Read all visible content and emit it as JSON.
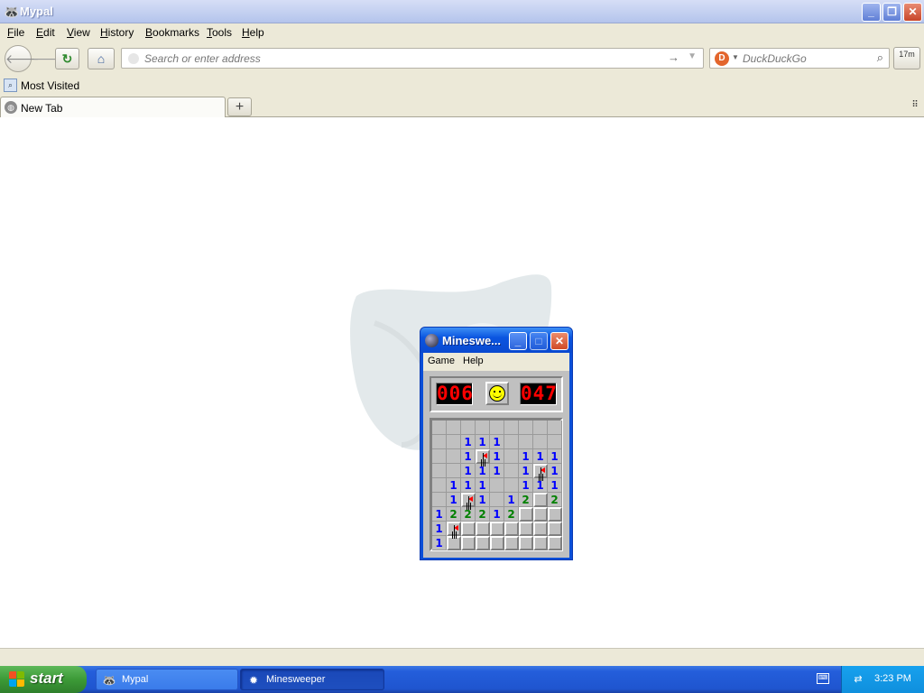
{
  "browser": {
    "title": "Mypal",
    "menu": [
      "File",
      "Edit",
      "View",
      "History",
      "Bookmarks",
      "Tools",
      "Help"
    ],
    "address_placeholder": "Search or enter address",
    "search_placeholder": "DuckDuckGo",
    "extension_label": "17m",
    "bookmarks": [
      "Most Visited"
    ],
    "tabs": [
      "New Tab"
    ]
  },
  "minesweeper": {
    "title": "Mineswe...",
    "menu": [
      "Game",
      "Help"
    ],
    "mine_counter": "006",
    "timer": "047",
    "grid": [
      [
        "",
        "",
        "",
        "",
        "",
        "",
        "",
        "",
        ""
      ],
      [
        "",
        "",
        "1",
        "1",
        "1",
        "",
        "",
        "",
        ""
      ],
      [
        "",
        "",
        "1",
        "F",
        "1",
        "",
        "1",
        "1",
        "1"
      ],
      [
        "",
        "",
        "1",
        "1",
        "1",
        "",
        "1",
        "F",
        "1"
      ],
      [
        "",
        "1",
        "1",
        "1",
        "",
        "",
        "1",
        "1",
        "1"
      ],
      [
        "",
        "1",
        "F",
        "1",
        "",
        "1",
        "2",
        "#",
        "2"
      ],
      [
        "1",
        "2",
        "2",
        "2",
        "1",
        "2",
        "#",
        "#",
        "#"
      ],
      [
        "1",
        "F",
        "#",
        "#",
        "#",
        "#",
        "#",
        "#",
        "#"
      ],
      [
        "1",
        "#",
        "#",
        "#",
        "#",
        "#",
        "#",
        "#",
        "#"
      ]
    ]
  },
  "taskbar": {
    "start_label": "start",
    "tasks": [
      "Mypal",
      "Minesweeper"
    ],
    "clock": "3:23 PM"
  }
}
